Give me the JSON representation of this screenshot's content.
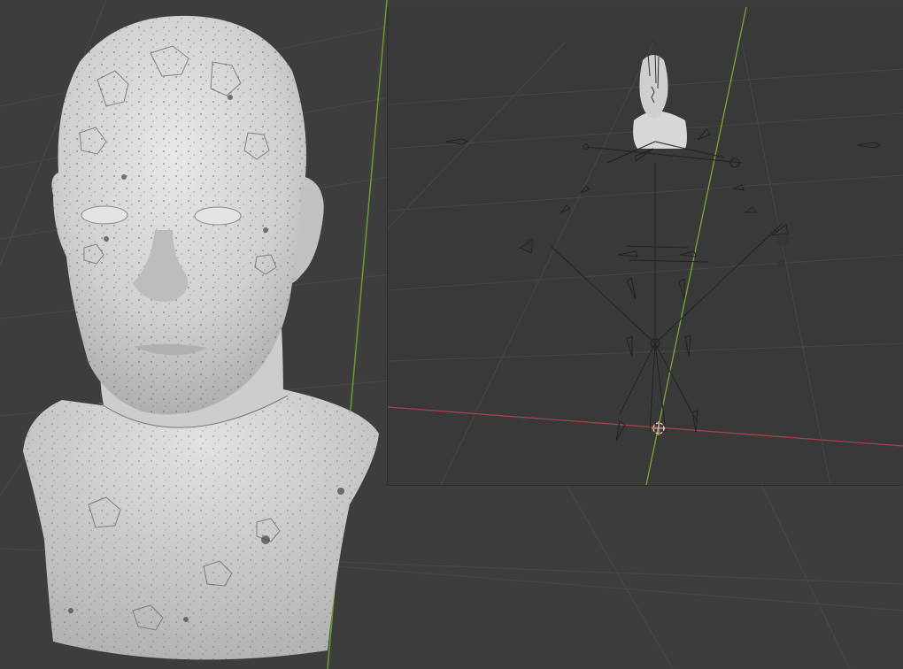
{
  "viewport_main": {
    "background": "#3d3d3d",
    "grid_color": "#4a4a4a",
    "axis_y_color": "#6b9a2e",
    "object": "head-bust-mesh",
    "mesh_color": "#d6d6d6",
    "texture_pattern": "speckled-wireframe"
  },
  "viewport_inset": {
    "background": "#393939",
    "grid_color": "#474747",
    "axis_x_color": "#a8404c",
    "axis_y_color": "#7aa83a",
    "objects": [
      "head-bust-mesh",
      "armature-rig",
      "3d-cursor"
    ],
    "cursor_color": "#e0a050"
  },
  "icons": {
    "cursor": "3d-cursor-icon",
    "armature": "armature-bones-icon"
  }
}
